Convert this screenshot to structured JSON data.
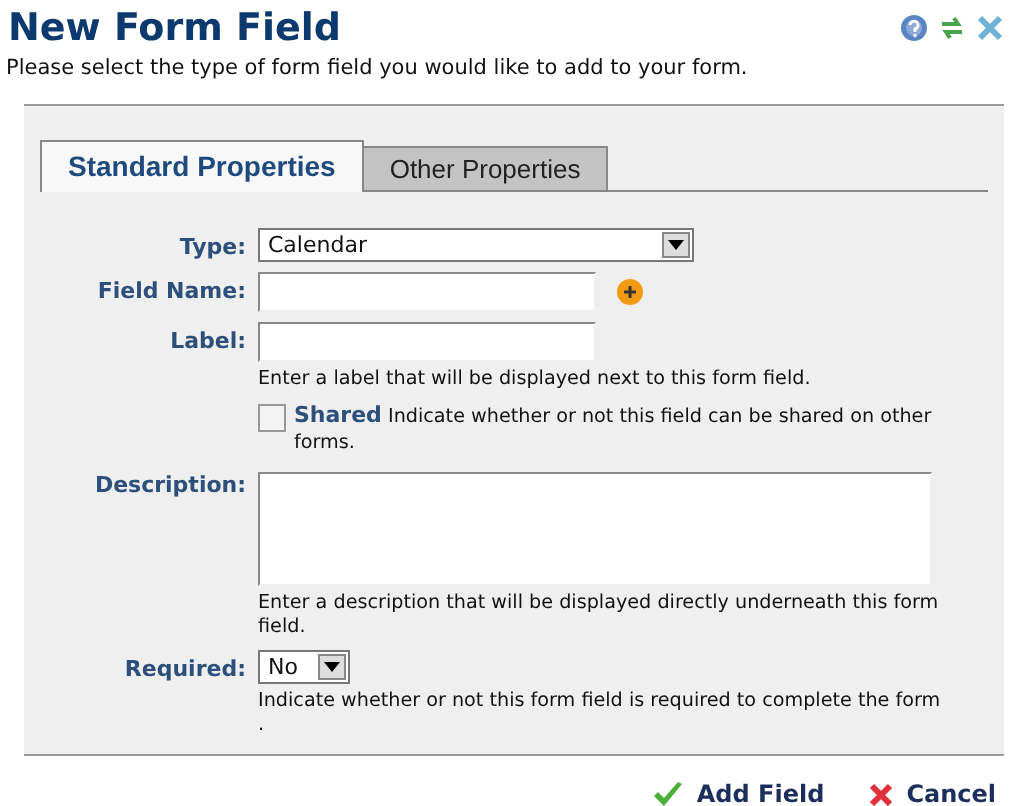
{
  "header": {
    "title": "New Form Field",
    "subtitle": "Please select the type of form field you would like to add to your form."
  },
  "tabs": [
    {
      "label": "Standard Properties",
      "selected": true
    },
    {
      "label": "Other Properties",
      "selected": false
    }
  ],
  "fields": [
    {
      "kind": "dropdown",
      "label": "Type:",
      "value": "Calendar"
    },
    {
      "kind": "text-with-button",
      "label": "Field Name:"
    },
    {
      "kind": "text",
      "label": "Label:",
      "hint": "Enter a label that will be displayed next to this form field."
    },
    {
      "kind": "checkbox",
      "checked": false,
      "text": "**Shared** Indicate whether or not this field can be shared on other forms."
    },
    {
      "kind": "textarea",
      "label": "Description:",
      "hint": "Enter a description that will be displayed directly underneath this form field."
    },
    {
      "kind": "compact-dropdown",
      "label": "Required:",
      "value": "No",
      "hint": "Indicate whether or not this form field is required to complete the form ."
    }
  ],
  "buttons": [
    {
      "kind": "confirm",
      "label": "Add Field"
    },
    {
      "kind": "cancel",
      "label": "Cancel"
    }
  ]
}
